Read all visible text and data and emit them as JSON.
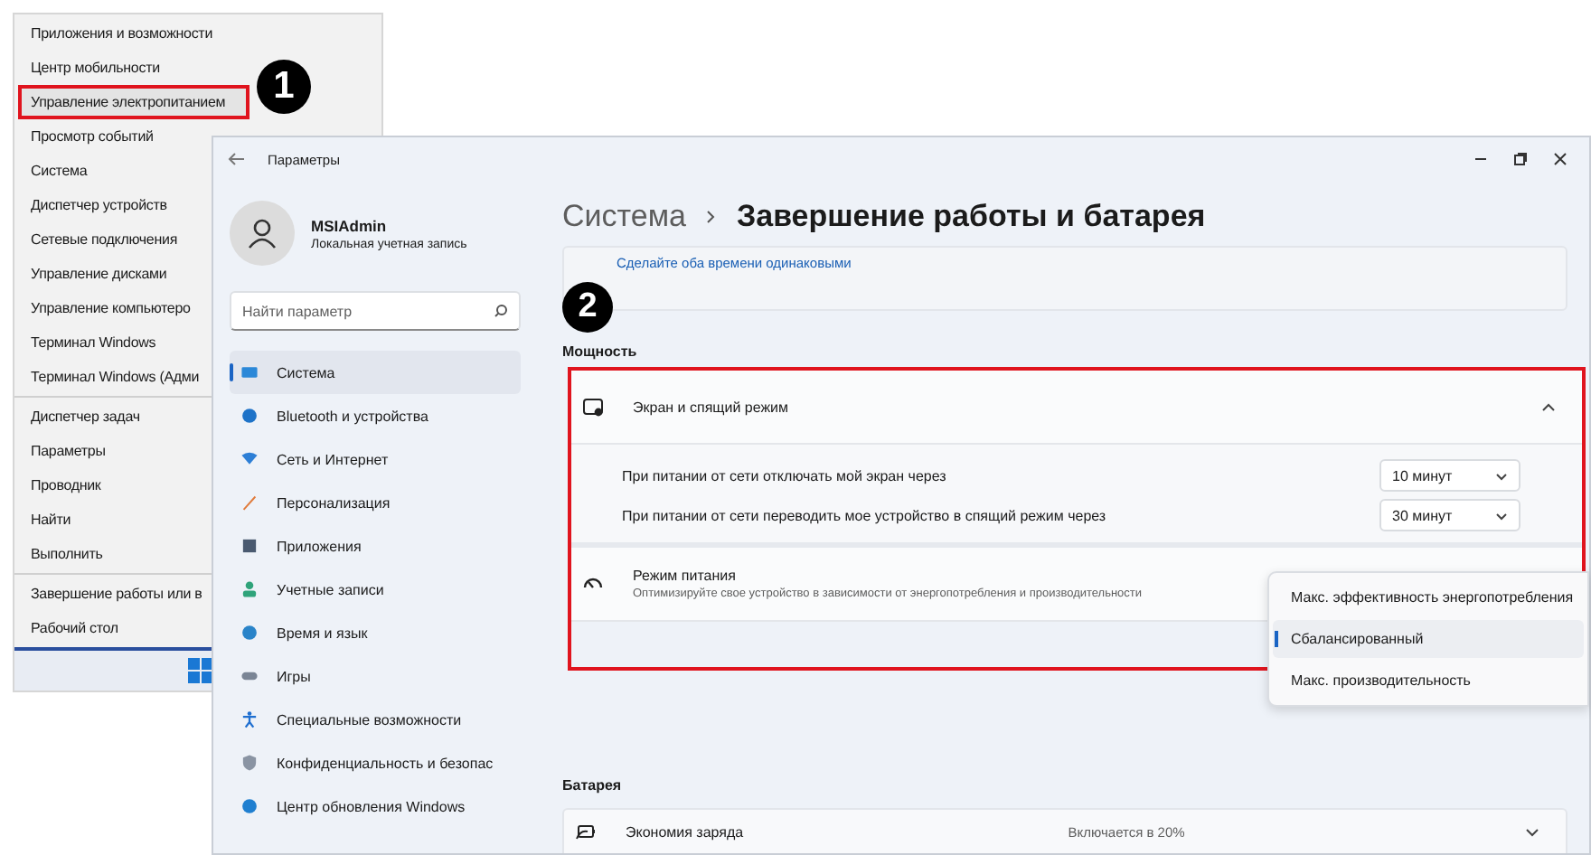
{
  "start_menu": {
    "callout": "1",
    "sections": [
      [
        {
          "label": "Приложения и возможности",
          "selected": false
        },
        {
          "label": "Центр мобильности",
          "selected": false
        },
        {
          "label": "Управление электропитанием",
          "selected": true
        },
        {
          "label": "Просмотр событий",
          "selected": false
        },
        {
          "label": "Система",
          "selected": false
        },
        {
          "label": "Диспетчер устройств",
          "selected": false
        },
        {
          "label": "Сетевые подключения",
          "selected": false
        },
        {
          "label": "Управление дисками",
          "selected": false
        },
        {
          "label": "Управление компьютеро",
          "selected": false
        },
        {
          "label": "Терминал Windows",
          "selected": false
        },
        {
          "label": "Терминал Windows (Адми",
          "selected": false
        }
      ],
      [
        {
          "label": "Диспетчер задач",
          "selected": false
        },
        {
          "label": "Параметры",
          "selected": false
        },
        {
          "label": "Проводник",
          "selected": false
        },
        {
          "label": "Найти",
          "selected": false
        },
        {
          "label": "Выполнить",
          "selected": false
        }
      ],
      [
        {
          "label": "Завершение работы или в",
          "selected": false
        },
        {
          "label": "Рабочий стол",
          "selected": false
        }
      ]
    ]
  },
  "settings": {
    "window": {
      "title": "Параметры"
    },
    "user": {
      "name": "MSIAdmin",
      "account_type": "Локальная учетная запись"
    },
    "search": {
      "placeholder": "Найти параметр"
    },
    "nav": [
      {
        "label": "Система",
        "selected": true
      },
      {
        "label": "Bluetooth и устройства",
        "selected": false
      },
      {
        "label": "Сеть и Интернет",
        "selected": false
      },
      {
        "label": "Персонализация",
        "selected": false
      },
      {
        "label": "Приложения",
        "selected": false
      },
      {
        "label": "Учетные записи",
        "selected": false
      },
      {
        "label": "Время и язык",
        "selected": false
      },
      {
        "label": "Игры",
        "selected": false
      },
      {
        "label": "Специальные возможности",
        "selected": false
      },
      {
        "label": "Конфиденциальность и безопас",
        "selected": false
      },
      {
        "label": "Центр обновления Windows",
        "selected": false
      }
    ],
    "breadcrumb": {
      "parent": "Система",
      "current": "Завершение работы и батарея"
    },
    "link": "Сделайте оба времени одинаковыми",
    "power": {
      "callout": "2",
      "title": "Мощность",
      "screen_sleep": {
        "title": "Экран и спящий режим",
        "expanded": true,
        "settings": [
          {
            "label": "При питании от сети отключать мой экран через",
            "value": "10 минут"
          },
          {
            "label": "При питании от сети переводить мое устройство в спящий режим через",
            "value": "30 минут"
          }
        ]
      },
      "power_mode": {
        "title": "Режим питания",
        "description": "Оптимизируйте свое устройство в зависимости от энергопотребления и производительности",
        "options": [
          {
            "label": "Макс. эффективность энергопотребления",
            "selected": false
          },
          {
            "label": "Сбалансированный",
            "selected": true
          },
          {
            "label": "Макс. производительность",
            "selected": false
          }
        ]
      }
    },
    "battery": {
      "title": "Батарея",
      "saver": {
        "title": "Экономия заряда",
        "value": "Включается в 20%"
      }
    }
  }
}
